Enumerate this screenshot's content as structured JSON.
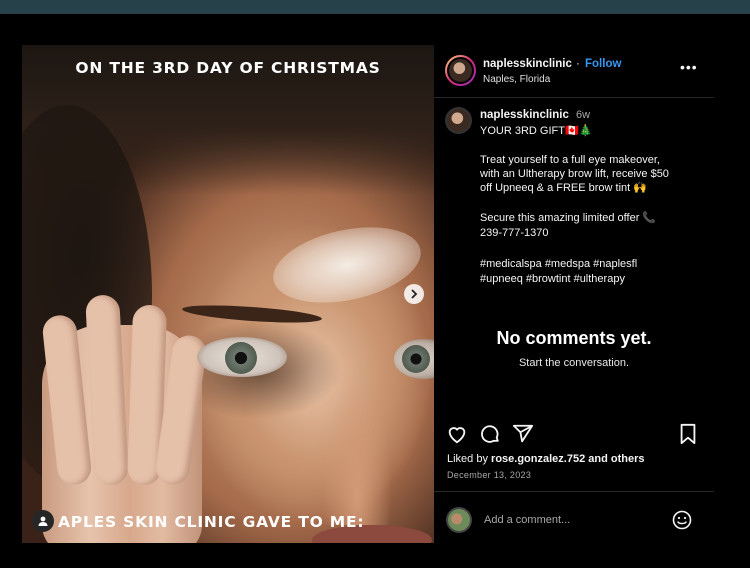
{
  "post": {
    "image": {
      "title_overlay": "ON THE 3RD DAY OF CHRISTMAS",
      "bottom_overlay": "APLES SKIN CLINIC GAVE TO ME:"
    },
    "header": {
      "username": "naplesskinclinic",
      "separator": "·",
      "follow_label": "Follow",
      "location": "Naples, Florida",
      "more_label": "•••"
    },
    "caption": {
      "username": "naplesskinclinic",
      "time_ago": "6w",
      "lines": [
        "YOUR 3RD GIFT🇨🇦🎄",
        "Treat yourself to a full eye makeover,",
        "with an Ultherapy brow lift, receive $50",
        "off Upneeq & a FREE brow tint 🙌",
        "Secure this amazing limited offer 📞",
        "239-777-1370",
        "#medicalspa #medspa #naplesfl",
        "#upneeq #browtint #ultherapy"
      ]
    },
    "comments": {
      "empty_title": "No comments yet.",
      "empty_subtitle": "Start the conversation."
    },
    "likes": {
      "prefix": "Liked by",
      "user": "rose.gonzalez.752",
      "suffix": "and others"
    },
    "date": "December 13, 2023",
    "comment_input": {
      "placeholder": "Add a comment..."
    },
    "icons": [
      "heart-icon",
      "comment-icon",
      "share-icon",
      "bookmark-icon",
      "emoji-icon",
      "tag-user-icon",
      "chevron-right-icon"
    ],
    "colors": {
      "follow": "#3897f0",
      "background": "#000000",
      "top_band": "#27414a"
    }
  }
}
